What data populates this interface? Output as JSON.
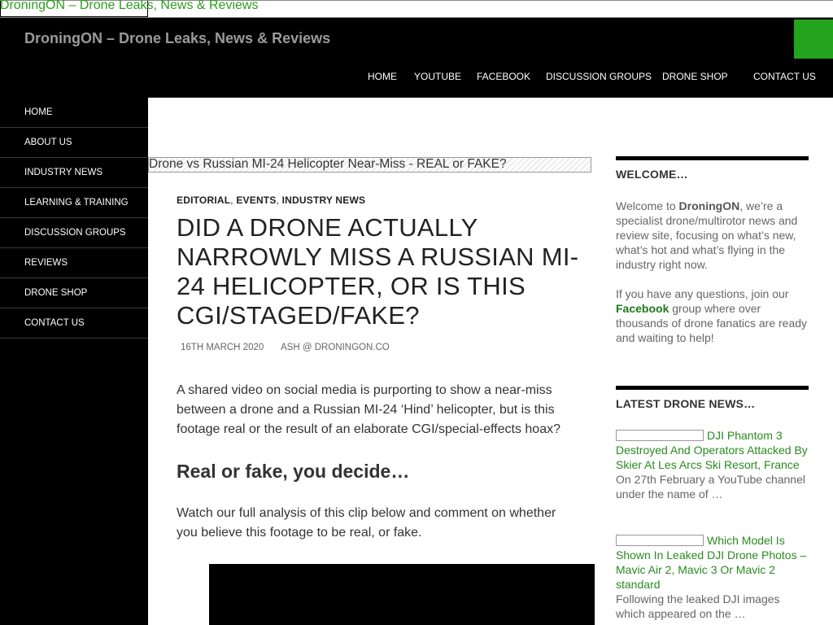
{
  "skip_link": "DroningON – Drone Leaks, News & Reviews",
  "site_title": "DroningON – Drone Leaks, News & Reviews",
  "colors": {
    "accent": "#24a31f",
    "link": "#2a8a20",
    "header_bg": "#000000"
  },
  "top_nav": [
    "HOME",
    "YOUTUBE",
    "FACEBOOK",
    "DISCUSSION GROUPS",
    "DRONE SHOP",
    "CONTACT US"
  ],
  "side_nav": [
    "HOME",
    "ABOUT US",
    "INDUSTRY NEWS",
    "LEARNING & TRAINING",
    "DISCUSSION GROUPS",
    "REVIEWS",
    "DRONE SHOP",
    "CONTACT US"
  ],
  "banner_title": "Drone vs Russian MI-24 Helicopter Near-Miss - REAL or FAKE?",
  "post": {
    "categories": [
      "EDITORIAL",
      "EVENTS",
      "INDUSTRY NEWS"
    ],
    "title": "DID A DRONE ACTUALLY NARROWLY MISS A RUSSIAN MI-24 HELICOPTER, OR IS THIS CGI/STAGED/FAKE?",
    "date": "16TH MARCH 2020",
    "author": "ASH @ DRONINGON.CO",
    "intro": "A shared video on social media is purporting to show a near-miss between a drone and a Russian MI-24 ‘Hind’ helicopter, but is this footage real or the result of an elaborate CGI/special-effects hoax?",
    "subheading": "Real or fake, you decide…",
    "body": "Watch our full analysis of this clip below and comment on whether you believe this footage to be real, or fake."
  },
  "welcome": {
    "title": "WELCOME…",
    "p1_a": "Welcome to ",
    "p1_brand": "DroningON",
    "p1_b": ", we’re a specialist drone/multirotor news and review site, focusing on what’s new, what’s hot and what’s flying in the industry right now.",
    "p2_a": "If you have any questions,  join our ",
    "p2_link": "Facebook",
    "p2_b": " group where over thousands of drone fanatics are ready and waiting to help!"
  },
  "latest": {
    "title": "LATEST DRONE NEWS…",
    "items": [
      {
        "title": "DJI Phantom 3 Destroyed And Operators Attacked By Skier At Les Arcs Ski Resort, France",
        "excerpt": "On 27th February a YouTube channel under the name of …"
      },
      {
        "title": "Which Model Is Shown In Leaked DJI Drone Photos – Mavic Air 2, Mavic 3 Or Mavic 2 standard",
        "excerpt": "Following the leaked DJI images which appeared on the …"
      }
    ]
  }
}
